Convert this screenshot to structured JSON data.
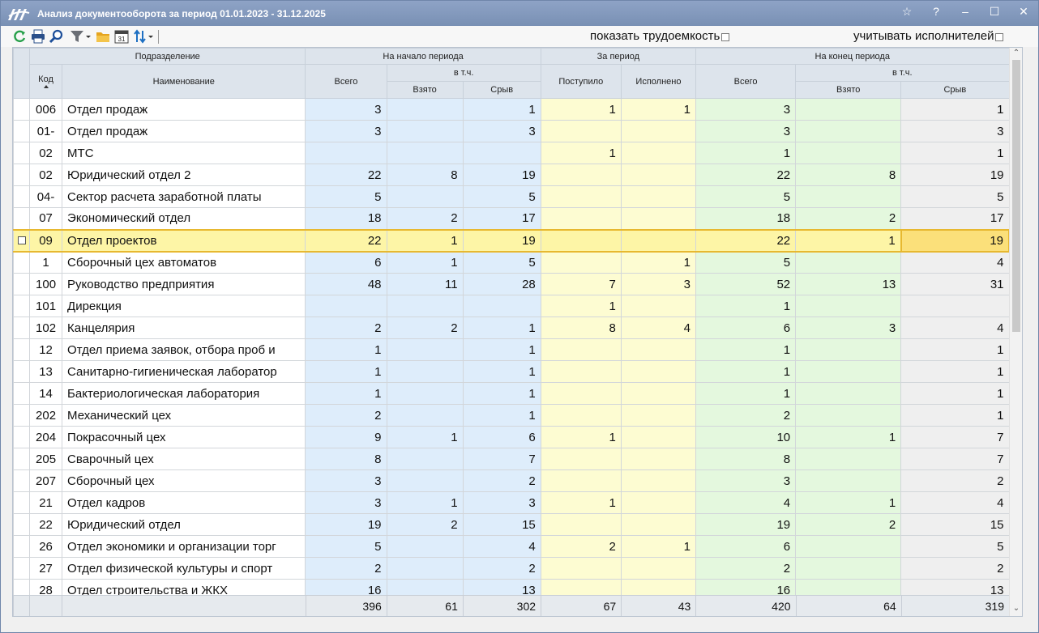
{
  "window": {
    "title": "Анализ документооборота за период 01.01.2023 - 31.12.2025",
    "controls": [
      "☆",
      "?",
      "–",
      "☐",
      "✕"
    ]
  },
  "toolbar": {
    "icons": [
      "refresh-icon",
      "print-icon",
      "search-icon",
      "filter-icon",
      "folder-icon",
      "calendar-icon",
      "sort-icon"
    ],
    "calendar_day": "31",
    "show_labor": "показать трудоемкость",
    "consider_executors": "учитывать исполнителей"
  },
  "header": {
    "division": "Подразделение",
    "code": "Код",
    "name": "Наименование",
    "start_period": "На начало периода",
    "in_period": "За период",
    "end_period": "На конец периода",
    "total": "Всего",
    "including": "в т.ч.",
    "taken": "Взято",
    "failed": "Срыв",
    "received": "Поступило",
    "done": "Исполнено"
  },
  "rows": [
    {
      "code": "006",
      "name": "Отдел продаж",
      "s_total": "3",
      "s_taken": "",
      "s_failed": "1",
      "received": "1",
      "done": "1",
      "e_total": "3",
      "e_taken": "",
      "e_failed": "1"
    },
    {
      "code": "01-",
      "name": "Отдел продаж",
      "s_total": "3",
      "s_taken": "",
      "s_failed": "3",
      "received": "",
      "done": "",
      "e_total": "3",
      "e_taken": "",
      "e_failed": "3"
    },
    {
      "code": "02",
      "name": "МТС",
      "s_total": "",
      "s_taken": "",
      "s_failed": "",
      "received": "1",
      "done": "",
      "e_total": "1",
      "e_taken": "",
      "e_failed": "1"
    },
    {
      "code": "02",
      "name": "Юридический отдел 2",
      "s_total": "22",
      "s_taken": "8",
      "s_failed": "19",
      "received": "",
      "done": "",
      "e_total": "22",
      "e_taken": "8",
      "e_failed": "19"
    },
    {
      "code": "04-",
      "name": "Сектор расчета заработной платы",
      "s_total": "5",
      "s_taken": "",
      "s_failed": "5",
      "received": "",
      "done": "",
      "e_total": "5",
      "e_taken": "",
      "e_failed": "5"
    },
    {
      "code": "07",
      "name": "Экономический отдел",
      "s_total": "18",
      "s_taken": "2",
      "s_failed": "17",
      "received": "",
      "done": "",
      "e_total": "18",
      "e_taken": "2",
      "e_failed": "17"
    },
    {
      "code": "09",
      "name": "Отдел проектов",
      "s_total": "22",
      "s_taken": "1",
      "s_failed": "19",
      "received": "",
      "done": "",
      "e_total": "22",
      "e_taken": "1",
      "e_failed": "19",
      "selected": true
    },
    {
      "code": "1",
      "name": "Сборочный цех автоматов",
      "s_total": "6",
      "s_taken": "1",
      "s_failed": "5",
      "received": "",
      "done": "1",
      "e_total": "5",
      "e_taken": "",
      "e_failed": "4"
    },
    {
      "code": "100",
      "name": "Руководство предприятия",
      "s_total": "48",
      "s_taken": "11",
      "s_failed": "28",
      "received": "7",
      "done": "3",
      "e_total": "52",
      "e_taken": "13",
      "e_failed": "31"
    },
    {
      "code": "101",
      "name": "Дирекция",
      "s_total": "",
      "s_taken": "",
      "s_failed": "",
      "received": "1",
      "done": "",
      "e_total": "1",
      "e_taken": "",
      "e_failed": ""
    },
    {
      "code": "102",
      "name": "Канцелярия",
      "s_total": "2",
      "s_taken": "2",
      "s_failed": "1",
      "received": "8",
      "done": "4",
      "e_total": "6",
      "e_taken": "3",
      "e_failed": "4"
    },
    {
      "code": "12",
      "name": "Отдел приема заявок, отбора проб и",
      "s_total": "1",
      "s_taken": "",
      "s_failed": "1",
      "received": "",
      "done": "",
      "e_total": "1",
      "e_taken": "",
      "e_failed": "1"
    },
    {
      "code": "13",
      "name": "Санитарно-гигиеническая лаборатор",
      "s_total": "1",
      "s_taken": "",
      "s_failed": "1",
      "received": "",
      "done": "",
      "e_total": "1",
      "e_taken": "",
      "e_failed": "1"
    },
    {
      "code": "14",
      "name": "Бактериологическая лаборатория",
      "s_total": "1",
      "s_taken": "",
      "s_failed": "1",
      "received": "",
      "done": "",
      "e_total": "1",
      "e_taken": "",
      "e_failed": "1"
    },
    {
      "code": "202",
      "name": "Механический цех",
      "s_total": "2",
      "s_taken": "",
      "s_failed": "1",
      "received": "",
      "done": "",
      "e_total": "2",
      "e_taken": "",
      "e_failed": "1"
    },
    {
      "code": "204",
      "name": "Покрасочный цех",
      "s_total": "9",
      "s_taken": "1",
      "s_failed": "6",
      "received": "1",
      "done": "",
      "e_total": "10",
      "e_taken": "1",
      "e_failed": "7"
    },
    {
      "code": "205",
      "name": "Сварочный цех",
      "s_total": "8",
      "s_taken": "",
      "s_failed": "7",
      "received": "",
      "done": "",
      "e_total": "8",
      "e_taken": "",
      "e_failed": "7"
    },
    {
      "code": "207",
      "name": "Сборочный цех",
      "s_total": "3",
      "s_taken": "",
      "s_failed": "2",
      "received": "",
      "done": "",
      "e_total": "3",
      "e_taken": "",
      "e_failed": "2"
    },
    {
      "code": "21",
      "name": "Отдел кадров",
      "s_total": "3",
      "s_taken": "1",
      "s_failed": "3",
      "received": "1",
      "done": "",
      "e_total": "4",
      "e_taken": "1",
      "e_failed": "4"
    },
    {
      "code": "22",
      "name": "Юридический отдел",
      "s_total": "19",
      "s_taken": "2",
      "s_failed": "15",
      "received": "",
      "done": "",
      "e_total": "19",
      "e_taken": "2",
      "e_failed": "15"
    },
    {
      "code": "26",
      "name": "Отдел экономики и организации торг",
      "s_total": "5",
      "s_taken": "",
      "s_failed": "4",
      "received": "2",
      "done": "1",
      "e_total": "6",
      "e_taken": "",
      "e_failed": "5"
    },
    {
      "code": "27",
      "name": "Отдел физической культуры и спорт",
      "s_total": "2",
      "s_taken": "",
      "s_failed": "2",
      "received": "",
      "done": "",
      "e_total": "2",
      "e_taken": "",
      "e_failed": "2"
    },
    {
      "code": "28",
      "name": "Отдел строительства и ЖКХ",
      "s_total": "16",
      "s_taken": "",
      "s_failed": "13",
      "received": "",
      "done": "",
      "e_total": "16",
      "e_taken": "",
      "e_failed": "13"
    }
  ],
  "totals": {
    "s_total": "396",
    "s_taken": "61",
    "s_failed": "302",
    "received": "67",
    "done": "43",
    "e_total": "420",
    "e_taken": "64",
    "e_failed": "319"
  },
  "scrollbar": {
    "up": "⌃",
    "down": "⌄"
  }
}
